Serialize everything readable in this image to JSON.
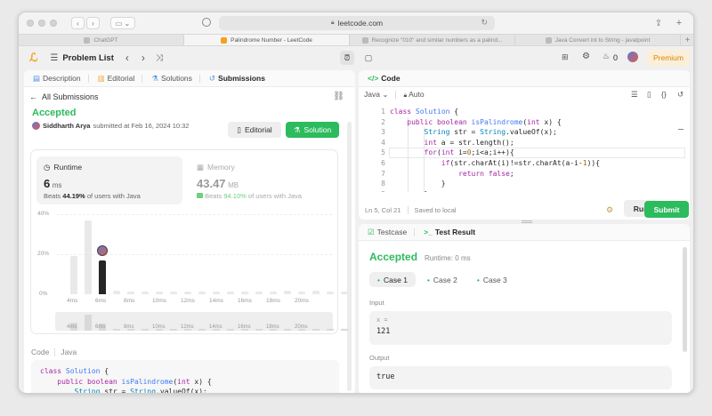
{
  "browser": {
    "url": "leetcode.com",
    "tabs": [
      {
        "label": "ChatGPT"
      },
      {
        "label": "Palindrome Number - LeetCode"
      },
      {
        "label": "Recognize \"010\" and similar numbers as a palind..."
      },
      {
        "label": "Java Convert int to String - javatpoint"
      }
    ]
  },
  "nav": {
    "problem_list": "Problem List",
    "fire_count": "0",
    "premium": "Premium"
  },
  "left": {
    "tabs": [
      "Description",
      "Editorial",
      "Solutions",
      "Submissions"
    ],
    "all_submissions": "All Submissions",
    "status": "Accepted",
    "user": "Siddharth Arya",
    "submitted_text": "submitted at Feb 16, 2024 10:32",
    "editorial_btn": "Editorial",
    "solution_btn": "Solution",
    "runtime": {
      "label": "Runtime",
      "value": "6",
      "unit": "ms",
      "beats_pre": "Beats",
      "beats_pct": "44.19%",
      "beats_post": "of users with Java"
    },
    "memory": {
      "label": "Memory",
      "value": "43.47",
      "unit": "MB",
      "beats_pre": "Beats",
      "beats_pct": "94.10%",
      "beats_post": "of users with Java"
    },
    "code_label": "Code",
    "code_lang": "Java",
    "code_lines": [
      "class Solution {",
      "    public boolean isPalindrome(int x) {",
      "        String str = String.valueOf(x);",
      "        int a = str.length();"
    ]
  },
  "chart_data": {
    "type": "bar",
    "ylabels": [
      "40%",
      "20%",
      "0%"
    ],
    "xlabels": [
      "4ms",
      "6ms",
      "8ms",
      "10ms",
      "12ms",
      "14ms",
      "16ms",
      "18ms",
      "20ms"
    ],
    "ylim": [
      0,
      40
    ],
    "values": [
      19,
      37,
      17,
      2,
      1,
      1,
      1,
      1,
      1,
      1,
      1,
      1,
      1,
      1,
      1,
      2,
      1,
      2,
      1,
      1,
      1,
      1
    ],
    "highlight_index": 2,
    "highlight_color": "#262626",
    "bar_color": "#e9e9e9"
  },
  "editor": {
    "title": "Code",
    "lang": "Java",
    "mode": "Auto",
    "line_numbers": [
      "1",
      "2",
      "3",
      "4",
      "5",
      "6",
      "7",
      "8",
      "9"
    ],
    "status": "Ln 5, Col 21",
    "saved": "Saved to local",
    "run": "Run",
    "submit": "Submit"
  },
  "result": {
    "testcase_tab": "Testcase",
    "result_tab": "Test Result",
    "status": "Accepted",
    "runtime": "Runtime: 0 ms",
    "cases": [
      "Case 1",
      "Case 2",
      "Case 3"
    ],
    "input_label": "Input",
    "input_var": "x =",
    "input_value": "121",
    "output_label": "Output",
    "output_value": "true"
  },
  "colors": {
    "accent_green": "#2cbb5d",
    "premium_bg": "#fcefd9",
    "premium_text": "#d48806"
  }
}
